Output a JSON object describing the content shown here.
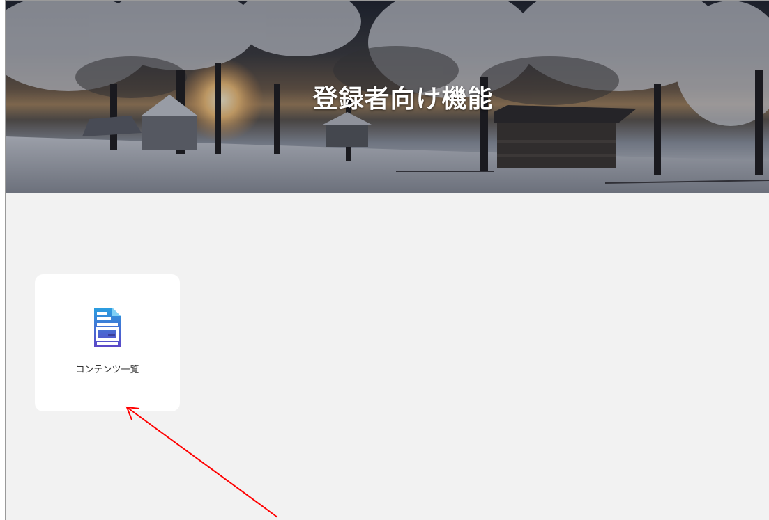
{
  "hero": {
    "title": "登録者向け機能"
  },
  "cards": [
    {
      "label": "コンテンツ一覧",
      "icon": "document-list-icon"
    }
  ],
  "colors": {
    "content_background": "#f2f2f2",
    "card_background": "#ffffff",
    "icon_gradient_top": "#2a9fe0",
    "icon_gradient_bottom": "#5b47c8",
    "annotation_arrow": "#ff0000"
  }
}
